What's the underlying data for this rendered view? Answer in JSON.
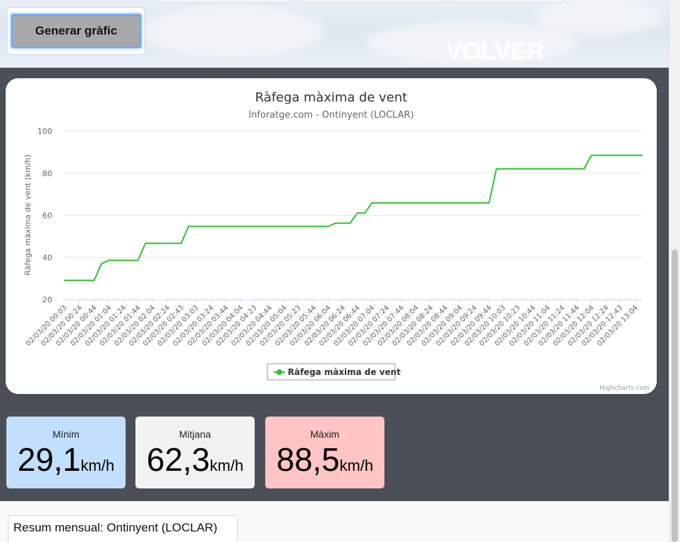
{
  "toolbar": {
    "generate_label": "Generar gràfic",
    "volver_label": "VOLVER"
  },
  "chart": {
    "credits": "Highcharts.com"
  },
  "chart_data": {
    "type": "line",
    "title": "Ràfega màxima de vent",
    "subtitle": "Inforatge.com - Ontinyent (LOCLAR)",
    "ylabel": "Ràfega màxima de vent (km/h)",
    "ylim": [
      20,
      100
    ],
    "yticks": [
      20,
      40,
      60,
      80,
      100
    ],
    "legend_position": "bottom-center",
    "series_color": "#2ec22e",
    "x_tick_labels": [
      "02/03/20 00:03",
      "02/03/20 00:24",
      "02/03/20 00:44",
      "02/03/20 01:04",
      "02/03/20 01:24",
      "02/03/20 01:44",
      "02/03/20 02:04",
      "02/03/20 02:24",
      "02/03/20 02:43",
      "02/03/20 03:03",
      "02/03/20 03:24",
      "02/03/20 03:44",
      "02/03/20 04:04",
      "02/03/20 04:23",
      "02/03/20 04:44",
      "02/03/20 05:04",
      "02/03/20 05:23",
      "02/03/20 05:44",
      "02/03/20 06:04",
      "02/03/20 06:24",
      "02/03/20 06:44",
      "02/03/20 07:04",
      "02/03/20 07:24",
      "02/03/20 07:44",
      "02/03/20 08:04",
      "02/03/20 08:24",
      "02/03/20 08:44",
      "02/03/20 09:04",
      "02/03/20 09:24",
      "02/03/20 09:44",
      "02/03/20 10:03",
      "02/03/20 10:23",
      "02/03/20 10:44",
      "02/03/20 11:04",
      "02/03/20 11:24",
      "02/03/20 11:44",
      "02/03/20 12:04",
      "02/03/20 12:24",
      "02/03/20 12:43",
      "02/03/20 13:04"
    ],
    "series": [
      {
        "name": "Ràfega màxima de vent",
        "points": [
          [
            "02/03/20 00:03",
            29.1
          ],
          [
            "02/03/20 00:44",
            29.1
          ],
          [
            "02/03/20 00:54",
            37.0
          ],
          [
            "02/03/20 01:04",
            38.6
          ],
          [
            "02/03/20 01:44",
            38.6
          ],
          [
            "02/03/20 01:54",
            46.7
          ],
          [
            "02/03/20 02:43",
            46.7
          ],
          [
            "02/03/20 02:53",
            54.7
          ],
          [
            "02/03/20 06:04",
            54.7
          ],
          [
            "02/03/20 06:14",
            56.3
          ],
          [
            "02/03/20 06:34",
            56.3
          ],
          [
            "02/03/20 06:44",
            61.1
          ],
          [
            "02/03/20 06:54",
            61.1
          ],
          [
            "02/03/20 07:04",
            65.9
          ],
          [
            "02/03/20 09:44",
            65.9
          ],
          [
            "02/03/20 09:54",
            82.1
          ],
          [
            "02/03/20 11:54",
            82.1
          ],
          [
            "02/03/20 12:04",
            88.5
          ],
          [
            "02/03/20 13:14",
            88.5
          ]
        ]
      }
    ]
  },
  "stats": [
    {
      "label": "Mínim",
      "value": "29,1",
      "unit": "km/h",
      "color": "#c2e0fd"
    },
    {
      "label": "Mitjana",
      "value": "62,3",
      "unit": "km/h",
      "color": "#f2f2f2"
    },
    {
      "label": "Màxim",
      "value": "88,5",
      "unit": "km/h",
      "color": "#ffc4c4"
    }
  ],
  "summary": {
    "label": "Resum mensual: Ontinyent (LOCLAR)"
  }
}
